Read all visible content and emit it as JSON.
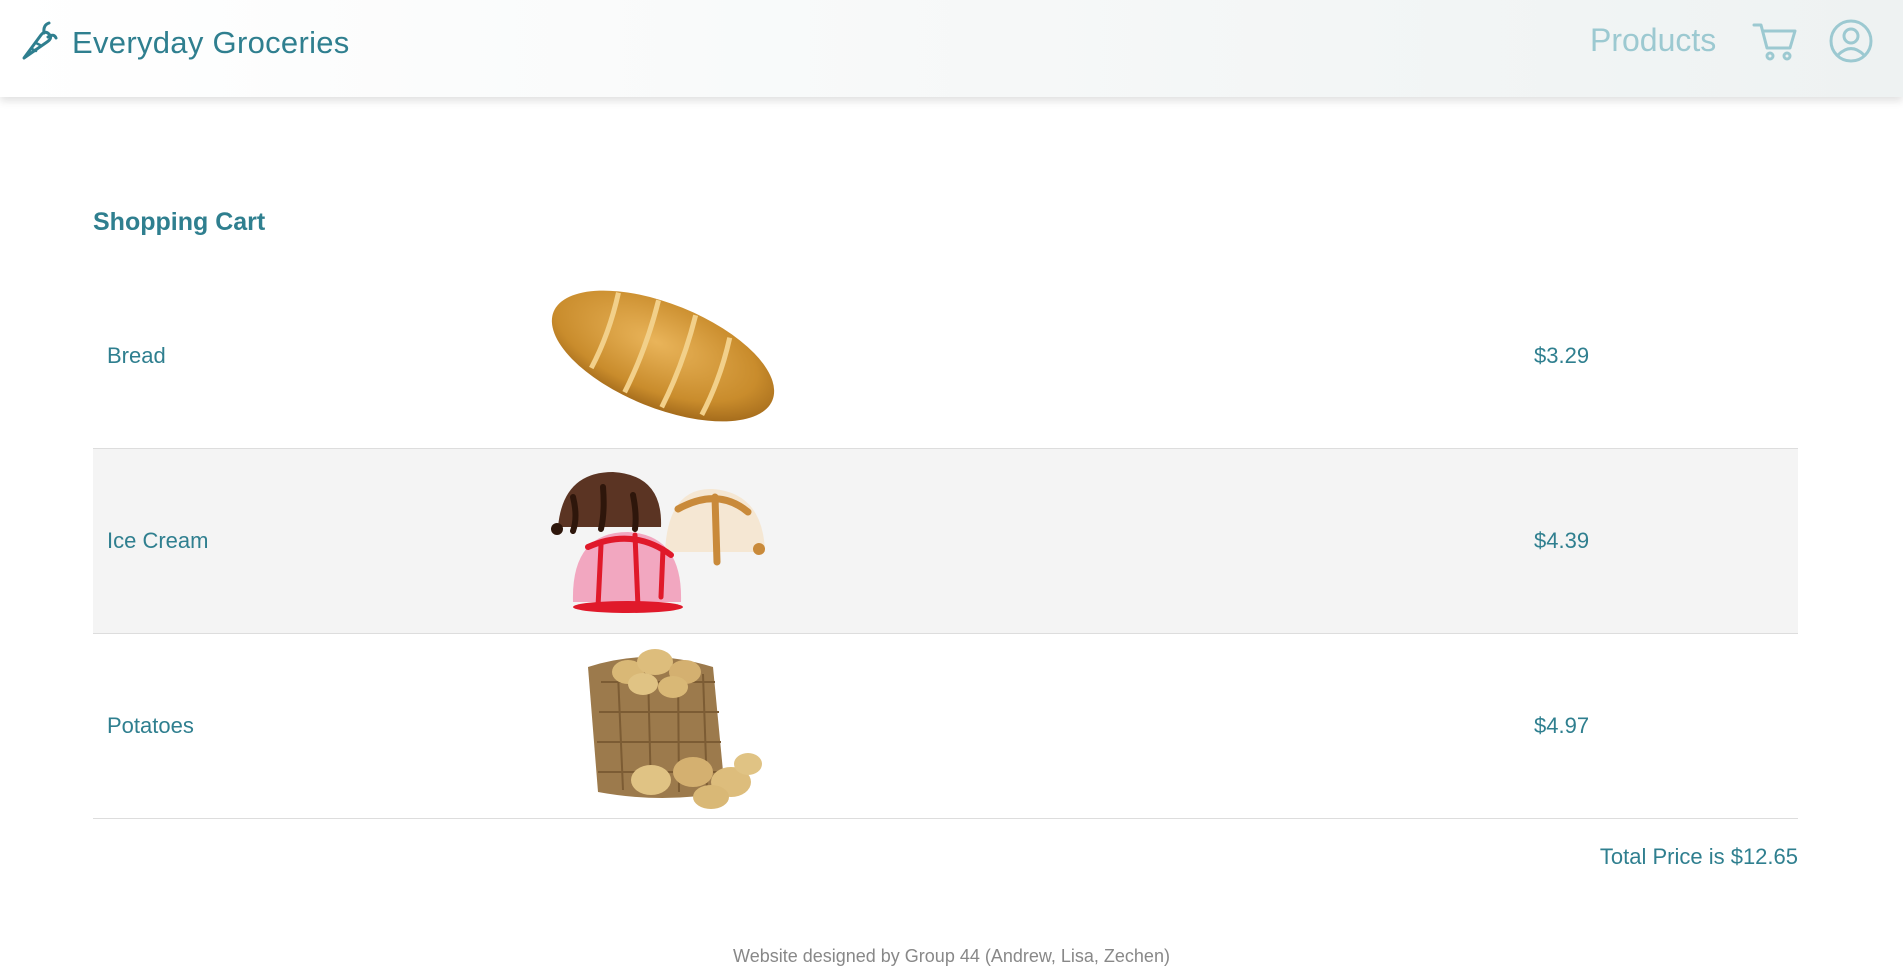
{
  "navbar": {
    "brand_icon": "carrot-icon",
    "brand_title": "Everyday Groceries",
    "products_label": "Products",
    "cart_icon": "cart-icon",
    "account_icon": "user-circle-icon"
  },
  "cart": {
    "title": "Shopping Cart",
    "items": [
      {
        "name": "Bread",
        "image": "bread-image",
        "price": "$3.29"
      },
      {
        "name": "Ice Cream",
        "image": "ice-cream-image",
        "price": "$4.39"
      },
      {
        "name": "Potatoes",
        "image": "potatoes-image",
        "price": "$4.97"
      }
    ],
    "total": "Total Price is $12.65"
  },
  "footer": {
    "text": "Website designed by Group 44 (Andrew, Lisa, Zechen)"
  },
  "colors": {
    "accent": "#2f7f8f",
    "nav_muted": "#9cc9d1",
    "row_shade": "#f4f4f4",
    "footer_text": "#888888"
  }
}
